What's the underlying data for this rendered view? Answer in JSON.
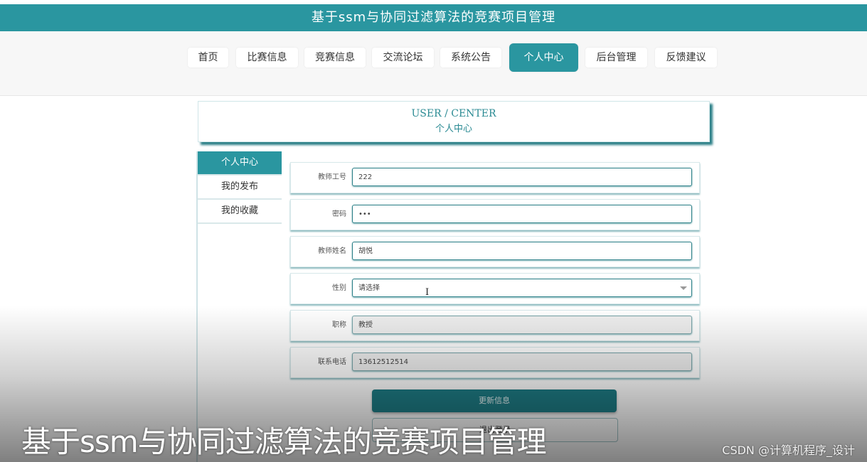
{
  "header": {
    "title": "基于ssm与协同过滤算法的竞赛项目管理"
  },
  "nav": {
    "items": [
      {
        "label": "首页"
      },
      {
        "label": "比赛信息"
      },
      {
        "label": "竞赛信息"
      },
      {
        "label": "交流论坛"
      },
      {
        "label": "系统公告"
      },
      {
        "label": "个人中心"
      },
      {
        "label": "后台管理"
      },
      {
        "label": "反馈建议"
      }
    ],
    "active": "个人中心"
  },
  "page_title": {
    "en": "USER / CENTER",
    "cn": "个人中心"
  },
  "sidebar": {
    "items": [
      {
        "label": "个人中心"
      },
      {
        "label": "我的发布"
      },
      {
        "label": "我的收藏"
      }
    ]
  },
  "form": {
    "teacher_id": {
      "label": "教师工号",
      "value": "222"
    },
    "password": {
      "label": "密码",
      "value": "•••"
    },
    "teacher_name": {
      "label": "教师姓名",
      "value": "胡悦"
    },
    "gender": {
      "label": "性别",
      "value": "请选择"
    },
    "title": {
      "label": "职称",
      "value": "教授"
    },
    "phone": {
      "label": "联系电话",
      "value": "13612512514"
    }
  },
  "buttons": {
    "update": "更新信息",
    "logout": "退出登录"
  },
  "overlay": {
    "caption": "基于ssm与协同过滤算法的竞赛项目管理",
    "watermark": "CSDN @计算机程序_设计"
  }
}
